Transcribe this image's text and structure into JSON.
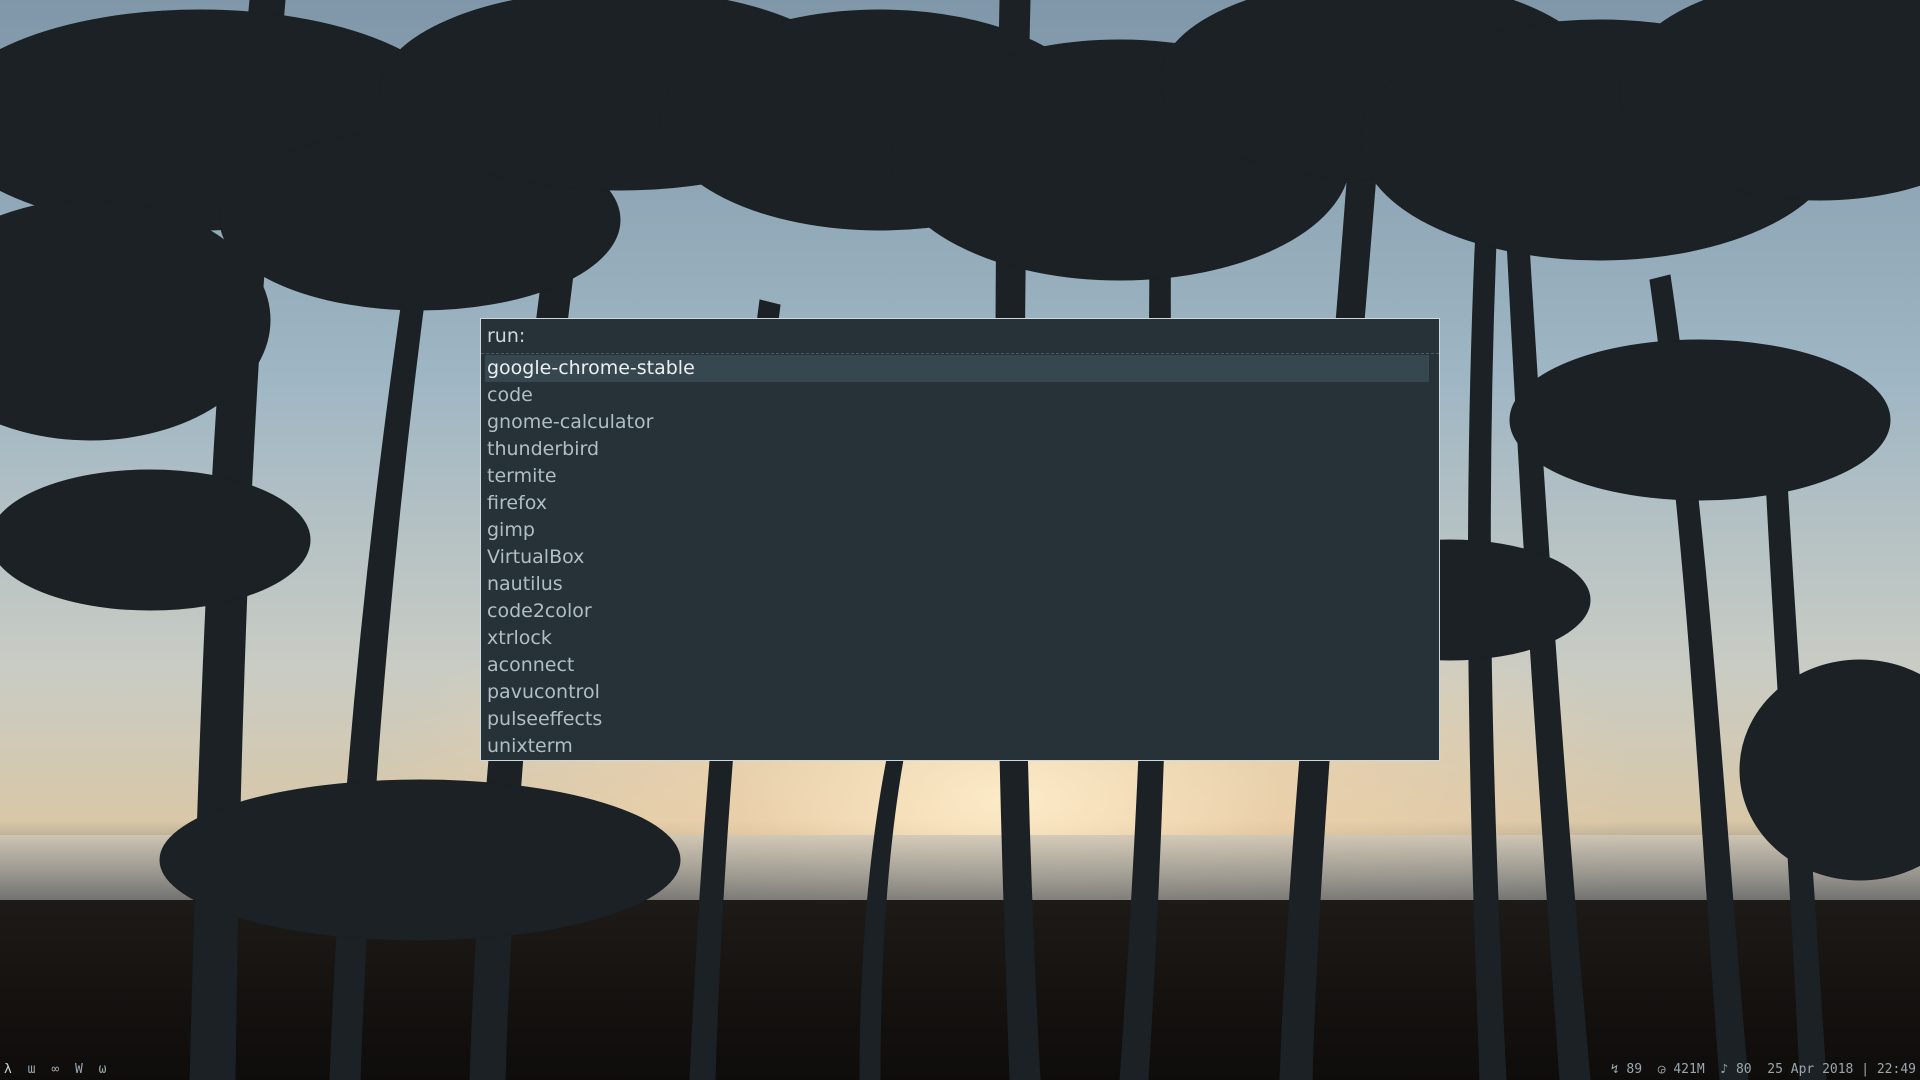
{
  "launcher": {
    "prompt_label": "run:",
    "input_value": "",
    "items": [
      {
        "label": "google-chrome-stable"
      },
      {
        "label": "code"
      },
      {
        "label": "gnome-calculator"
      },
      {
        "label": "thunderbird"
      },
      {
        "label": "termite"
      },
      {
        "label": "firefox"
      },
      {
        "label": "gimp"
      },
      {
        "label": "VirtualBox"
      },
      {
        "label": "nautilus"
      },
      {
        "label": "code2color"
      },
      {
        "label": "xtrlock"
      },
      {
        "label": "aconnect"
      },
      {
        "label": "pavucontrol"
      },
      {
        "label": "pulseeffects"
      },
      {
        "label": "unixterm"
      }
    ],
    "selected_index": 0
  },
  "statusbar": {
    "workspaces": [
      "λ",
      "ա",
      "∞",
      "W",
      "ω"
    ],
    "battery": "↯ 89",
    "memory": "◶ 421M",
    "volume": "♪ 80",
    "date": "25 Apr 2018",
    "separator": "|",
    "time": "22:49"
  },
  "colors": {
    "dialog_bg": "#263238",
    "selected_bg": "#37474f",
    "text": "#b0bec5",
    "selected_text": "#eceff1",
    "border": "#cfd8dc"
  }
}
